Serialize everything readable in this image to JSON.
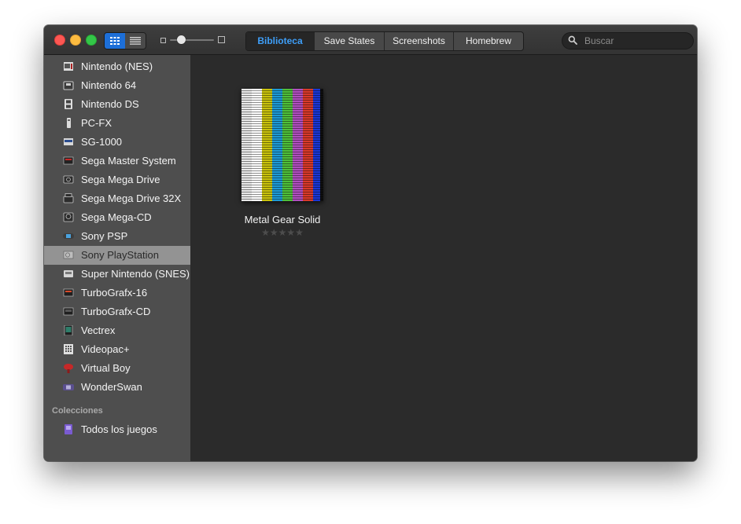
{
  "toolbar": {
    "view_modes": [
      {
        "name": "grid-view",
        "icon": "grid-icon",
        "active": true
      },
      {
        "name": "list-view",
        "icon": "list-icon",
        "active": false
      }
    ],
    "tabs": [
      {
        "label": "Biblioteca",
        "active": true
      },
      {
        "label": "Save States",
        "active": false
      },
      {
        "label": "Screenshots",
        "active": false
      },
      {
        "label": "Homebrew",
        "active": false
      }
    ],
    "search_placeholder": "Buscar"
  },
  "sidebar": {
    "systems": [
      {
        "label": "Nintendo (NES)",
        "icon": "nes-console-icon"
      },
      {
        "label": "Nintendo 64",
        "icon": "n64-console-icon"
      },
      {
        "label": "Nintendo DS",
        "icon": "nds-handheld-icon"
      },
      {
        "label": "PC-FX",
        "icon": "pcfx-console-icon"
      },
      {
        "label": "SG-1000",
        "icon": "sg1000-console-icon"
      },
      {
        "label": "Sega Master System",
        "icon": "master-system-console-icon"
      },
      {
        "label": "Sega Mega Drive",
        "icon": "mega-drive-console-icon"
      },
      {
        "label": "Sega Mega Drive 32X",
        "icon": "mega-drive-32x-console-icon"
      },
      {
        "label": "Sega Mega-CD",
        "icon": "mega-cd-console-icon"
      },
      {
        "label": "Sony PSP",
        "icon": "psp-handheld-icon"
      },
      {
        "label": "Sony PlayStation",
        "icon": "playstation-console-icon",
        "selected": true
      },
      {
        "label": "Super Nintendo (SNES)",
        "icon": "snes-console-icon"
      },
      {
        "label": "TurboGrafx-16",
        "icon": "turbografx16-console-icon"
      },
      {
        "label": "TurboGrafx-CD",
        "icon": "turbografx-cd-console-icon"
      },
      {
        "label": "Vectrex",
        "icon": "vectrex-console-icon"
      },
      {
        "label": "Videopac+",
        "icon": "videopac-console-icon"
      },
      {
        "label": "Virtual Boy",
        "icon": "virtual-boy-icon"
      },
      {
        "label": "WonderSwan",
        "icon": "wonderswan-handheld-icon"
      }
    ],
    "collections_header": "Colecciones",
    "collections": [
      {
        "label": "Todos los juegos",
        "icon": "collection-icon"
      }
    ]
  },
  "library": {
    "games": [
      {
        "title": "Metal Gear Solid",
        "rating": 0,
        "rating_max": 5,
        "rating_stars": "★★★★★",
        "cover": "color-bars-placeholder"
      }
    ]
  },
  "colors": {
    "accent": "#3e9ff9",
    "sidebar_bg": "#4e4e4e",
    "content_bg": "#2b2b2b",
    "selected_row": "#939393"
  }
}
